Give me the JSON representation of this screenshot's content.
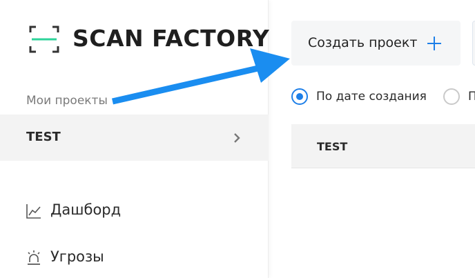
{
  "app": {
    "name": "SCAN FACTORY"
  },
  "sidebar": {
    "section_label": "Мои проекты",
    "project": {
      "name": "TEST"
    },
    "nav": [
      {
        "label": "Дашборд",
        "icon": "chart-line-icon"
      },
      {
        "label": "Угрозы",
        "icon": "alarm-light-icon"
      }
    ]
  },
  "main": {
    "create_button": {
      "label": "Создать проект",
      "icon": "plus-icon"
    },
    "sort": {
      "options": [
        {
          "label": "По дате создания",
          "selected": true
        },
        {
          "label": "П",
          "selected": false
        }
      ]
    },
    "table": {
      "columns": [
        "TEST"
      ]
    }
  },
  "colors": {
    "accent": "#1d7fe8",
    "logo_line": "#2ed39a",
    "arrow": "#1a8df0",
    "sidebar_active_bg": "#f3f3f3"
  }
}
